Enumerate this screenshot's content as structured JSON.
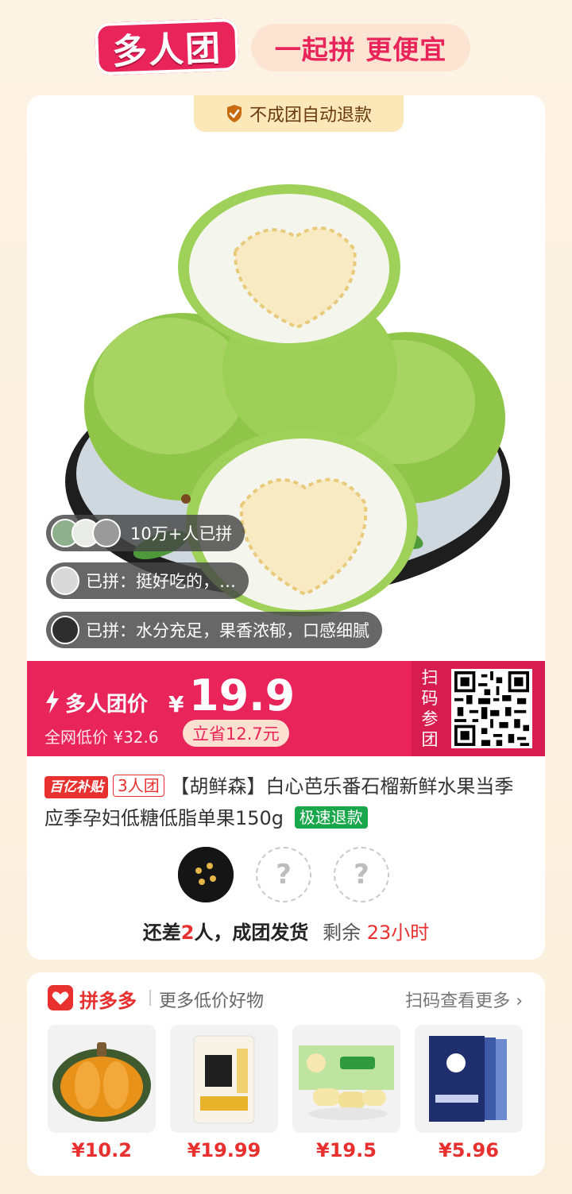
{
  "header": {
    "logo_text": "多人团",
    "slogan": "一起拼 更便宜"
  },
  "card": {
    "refund_badge": "不成团自动退款",
    "joined_count": "10万+人已拼",
    "reviews": [
      "已拼：挺好吃的，…",
      "已拼：水分充足，果香浓郁，口感细腻"
    ],
    "price": {
      "label": "多人团价",
      "currency": "¥",
      "value": "19.9",
      "lowest_label": "全网低价 ¥32.6",
      "save": "立省12.7元"
    },
    "scan_label": [
      "扫",
      "码",
      "参",
      "团"
    ],
    "tags": {
      "subsidy": "百亿补贴",
      "group": "3人团",
      "refund": "极速退款"
    },
    "title": "【胡鲜森】白心芭乐番石榴新鲜水果当季应季孕妇低糖低脂单果150g",
    "slot_placeholder": "?",
    "status": {
      "prefix": "还差",
      "count": "2",
      "suffix": "人，成团发货",
      "remain_label": "剩余",
      "remain_time": "23小时"
    }
  },
  "more": {
    "brand": "拼多多",
    "subtitle": "更多低价好物",
    "scan_more": "扫码查看更多",
    "goods": [
      {
        "price": "¥10.2",
        "icon": "pumpkin"
      },
      {
        "price": "¥19.99",
        "icon": "flour-bag"
      },
      {
        "price": "¥19.5",
        "icon": "corn-box"
      },
      {
        "price": "¥5.96",
        "icon": "diaper-pack"
      }
    ]
  },
  "colors": {
    "accent": "#e8245a",
    "badge_bg": "#fbe7b8",
    "refund_green": "#18a74a"
  }
}
